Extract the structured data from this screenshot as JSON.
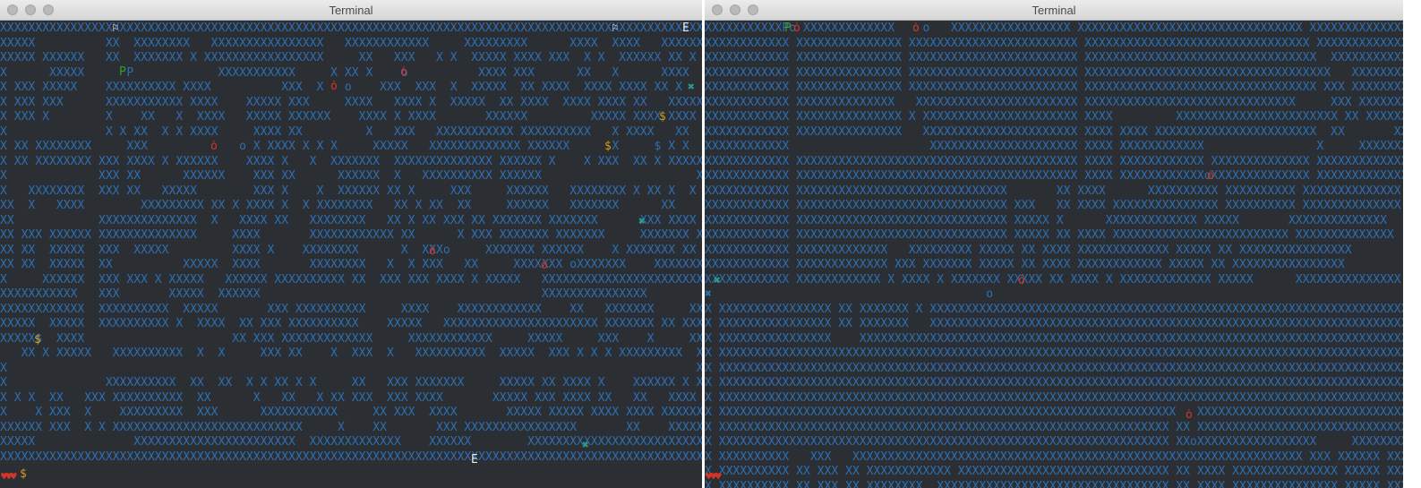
{
  "windows": [
    {
      "title": "Terminal",
      "map": [
        "XXXXXXXXXXXXXXXXXXXXXXXXXXXXXXXXXXXXXXXXXXXXXXXXXXXXXXXXXXXXXXXXXXXXXXXXXXXXXXXXXXXXXXXXXXXXXXXXXXXX",
        "XXXXX          XX  XXXXXXXX   XXXXXXXXXXXXXXXX   XXXXXXXXXXXX     XXXXXXXXX      XXXX  XXXX   XXXXXX",
        "XXXXX XXXXXX   XX  XXXXXXX X XXXXXXXXXXXXXXXXX     XX   XXX   X X  XXXXX XXXX XXX  X X  XXXXXX XX X",
        "X      XXXXX      P            XXXXXXXXXXX     X XX X    o          XXXX XXX      XX   X      XXXX",
        "X XXX XXXXX    XXXXXXXXXX XXXX          XXX  X   o    XXX  XXX  X  XXXXX  XX XXXX  XXXX XXXX XX X  ",
        "X XXX XXX      XXXXXXXXXXX XXXX    XXXXX XXX     XXXX   XXXX X  XXXXX  XX XXXX  XXXX XXXX XX   XXXXX",
        "X XXX X        X    XX   X  XXXX   XXXXX XXXXXX    XXXX X XXXX       XXXXXX         XXXXX XXXX XXXX $XX",
        "X              X X XX  X X XXXX     XXXX XX         X   XXX   XXXXXXXXXXX XXXXXXXXXX   X XXXX   XX  X",
        "X XX XXXXXXXX     XXX             o X XXXX X X X     XXXXX   XXXXXXXXXXXXX XXXXXX      X     $ X X  X",
        "X XX XXXXXXXX XXX XXXX X XXXXXX    XXXX X   X  XXXXXXX  XXXXXXXXXXXXXX XXXXXX X    X XXX  XX X XXXXX",
        "X             XXX XX      XXXXXX    XXX XX      XXXXXX  X   XXXXXXXXXX XXXXXX                      X",
        "X   XXXXXXXX  XXX XX   XXXXX        XXX X    X  XXXXXX XX X     XXX     XXXXXX   XXXXXXXX X XX X  X  X",
        "XX  X   XXXX        XXXXXXXXX XX X XXXX X  X XXXXXXXX   XX X XX  XX     XXXXXX   XXXXXXX      XX    XXX",
        "XX            XXXXXXXXXXXXXX  X   XXXX XX   XXXXXXXX   XX X XX XXX XX XXXXXXX XXXXXXX      XXX XXXX X",
        "XX XXX XXXXXX XXXXXXXXXXXXXX     XXXX       XXXXXXXXXXXX XX      X XXX XXXXXXX XXXXXXX     XXXXXXX XX",
        "XX XX  XXXXX  XXX  XXXXX         XXXX X    XXXXXXXX      X  XXXo     XXXXXXX XXXXXX    X XXXXXXX XX",
        "XX XX  XXXXX  XX          XXXXX  XXXX       XXXXXXXX   X  X XXX   XX     XXXXXXX oXXXXXXX    XXXXXXX XX",
        "X     XXXXXX  XXX XXX X XXXXX   XXXXXX XXXXXXXXXX XX  XXX XXX XXXX X XXXXX   XXXXXXXXXXXXXXXXXXXXXXX XX",
        "XXXXXXXXXXX   XXX       XXXXX  XXXXXX                                        XXXXXXXXXXXXXXX        XX",
        "XXXXXXXXXXXX  XXXXXXXXXX  XXXXX       XXX XXXXXXXXXX     XXXX    XXXXXXXXXXXX    XX   XXXXXXX     XXXX XX",
        "XXXXX  XXXXX  XXXXXXXXXX X  XXXX  XX XXX XXXXXXXXXX    XXXXX   XXXXXXXXXXXXXXXXXXXXXX XXXXXXX XX XXXX XX",
        "XXXXX$  XXXX                     XX XXX XXXXXXXXXXXXX     XXXXXXXXXXXX     XXXXX     XXX    X     XXXX   X",
        "   XX X XXXXX   XXXXXXXXXX  X  X     XXX XX    X  XXX  X   XXXXXXXXXX  XXXXX  XXX X X X XXXXXXXXX  X",
        "X                                                                                                  X",
        "X              XXXXXXXXXX  XX  XX  X X XX X X     XX   XXX XXXXXXX     XXXXX XX XXXX X    XXXXXX X XXX",
        "X X X  XX   XXX XXXXXXXXXX  XX      X   XX   X XX XXX  XXX XXXX       XXXXX XXX XXXX XX   XX   XXXX",
        "X    X XXX  X    XXXXXXXXX  XXX      XXXXXXXXXXX     XX XXX  XXXX       XXXXX XXXXX XXXX XXXX XXXXXXXX",
        "XXXXXX XXX  X X XXXXXXXXXXXXXXXXXXXXXXXXXXX     X    XX       XXX XXXXXXXXXXXXXXXX       XX    XXXXXXX",
        "XXXXX              XXXXXXXXXXXXXXXXXXXXXXX  XXXXXXXXXXXXX    XXXXXX        XXXXXXXXXXXXXXXXXXXXXXXXXXXXX",
        "XXXXXXXXXXXXXXXXXXXXXXXXXXXXXXXXXXXXXXXXXXXXXXXXXXXXXXXXXXXXXXXXXXXXXXXXXXXXXXXXXXXXXXXXXXXXXXXXXXXXXX"
      ],
      "markers": {
        "player": "P",
        "enemy": "ȯ",
        "gold": "$",
        "gem": "✖",
        "exit": "E",
        "flag": "⚐"
      },
      "hud": {
        "hearts": "♥♥♥",
        "gold": "$"
      }
    },
    {
      "title": "Terminal",
      "map": [
        "XXXXXXXXXXXPo XXXXXXXXXXXXX    o   XXXXXXXXXXXXXXXXX XXXXXXXXXXXXXXXXXXXXXXXXXXXXXXXX XXXXXXXXXXXXXX",
        "XXXXXXXXXXXX XXXXXXXXXXXXXXX XXXXXXXXXXXXXXXXXXXXXXXX XXXXXXXXXXXXXXXXXXXXXXXXXXXXXXXX XXXXXXXXXXXXXX",
        "XXXXXXXXXXXX XXXXXXXXXXXXXXX XXXXXXXXXXXXXXXXXXXXXXXX XXXXXXXXXXXXXXXXXXXXXXXXXXXXXXXXX  XXXXXXXXXXXX",
        "XXXXXXXXXXXX XXXXXXXXXXXXXXX XXXXXXXXXXXXXXXXXXXXXXXX XXXXXXXXXXXXXXXXXXXXXXXXXXXXXXXXXXX   XXXXXXXXX",
        "XXXXXXXXXXXX XXXXXXXXXXXXXXX XXXXXXXXXXXXXXXXXXXXXXXX XXXXXXXXXXXXXXXXXXXXXXXXXXXXXXXXX XXX XXXXXXXX",
        "XXXXXXXXXXXX XXXXXXXXXXXXXX   XXXXXXXXXXXXXXXXXXXXXXX XXXXXXXXXXXXXXXXXXXXXXXXXXXXXX     XXX XXXXXXXX",
        "XXXXXXXXXXXX XXXXXXXXXXXXXXX X XXXXXXXXXXXXXXXXXXXXXX XXXX         XXXXXXXXXXXXXXXXXXXXXXX XX XXXXXXXXX",
        "XXXXXXXXXXXX XXXXXXXXXXXXXXX   XXXXXXXXXXXXXXXXXXXXXX XXXX XXXX XXXXXXXXXXXXXXXXXXXXXXX  XX       XXXX",
        "XXXXXXXXXXXX                    XXXXXXXXXXXXXXXXXXXXX XXXX XXXXXXXXXXXX                X     XXXXXXXXXX",
        "XXXXXXXXXXXX XXXXXXXXXXXXXXXXXXXXXXXXXXXXXXXXXXXXXXXX XXXX XXXXXXXXXXXX XXXXXXXXXXXXXX XXXXXXXXXXXXXX",
        "XXXXXXXXXXXX XXXXXXXXXXXXXXXXXXXXXXXXXXXXXXXXXXXXXXXX XXXX XXXXXXXXXXXXoXXXXXXXXXXXXXX XXXXXXXXXXXXXX",
        "XXXXXXXXXXXX XXXXXXXXXXXXXXXXXXXXXXXXXXXXXX       XX XXXX      XXXXXXXXXX XXXXXXXXXX XXXXXXXXXXXXXX",
        "XXXXXXXXXXXX XXXXXXXXXXXXXXXXXXXXXXXXXXXXXX XXX   XX XXXX XXXXXXXXXXXXXXX XXXXXXXXXX XXXXXXXXXXXXXX",
        "XXXXXXXXXXXX XXXXXXXXXXXXXXXXXXXXXXXXXXXXXX XXXXX X      XXXXXXXXXXXXX XXXXX       XXXXXXXXXXXXXX",
        "XXXXXXXXXXXX XXXXXXXXXXXXXXXXXXXXXXXXXXXXXX XXXXX XX XXXX XXXXXXXXXXXXXXXXXXXXXXXXX XXXXXXXXXXXXXX",
        "XXXXXXXXXXXX XXXXXXXXXXXXX   XXXXXXXXX XXXXX XX XXXX XXXXXXXXXXXXX XXXXX XX XXXXXXXXXXXXXXXX",
        "XXXXXXXXXXXX XXXXXXXXXXXXX XXX XXXXXXX XXXXX XX XXXX XXXXXXXXXXXX XXXXX XX XXXXXXXXXXXXXXXX",
        "XXXXXXXXXXXX XXXXXXXXXXXX X XXXX X XXXXXXX XXXXX XX XXXX X XXXXXXXXXXXXX XXXXX      XXXXXXXXXXXXXXX",
        "✖                                       o                                                          ",
        "X XXXXXXXXXXXXXXXX XX XXXXXXX X XXXXXXXXXXXXXXXXXXXXXXXXXXXXXXXXXXXXXXXXXXXXXXXXXXXXXXXXXXXXXXXXXXXXXX",
        "X XXXXXXXXXXXXXXXX XX XXXXXXX   XXXXXXXXXXXXXXXXXXXXXXXXXXXXXXXXXXXXXXXXXXXXXXXXXXXXXXXXXXXXXXXXXXXXXX",
        "X XXXXXXXXXXXXXXXX    XXXXXXXXXXXXXXXXXXXXXXXXXXXXXXXXXXXXXXXXXXXXXXXXXXXXXXXXXXXXXXXXXXXXXXXXXXXXXXX",
        "X XXXXXXXXXXXXXXXXXXXXXXXXXXXXXXXXXXXXXXXXXXXXXXXXXXXXXXXXXXXXXXXXXXXXXXXXXXXXXXXXXXXXXXXXXXXXXXXXXXXX",
        "X XXXXXXXXXXXXXXXXXXXXXXXXXXXXXXXXXXXXXXXXXXXXXXXXXXXXXXXXXXXXXXXXXXXXXXXXXXXXXXXXXXXXXXXXXXXXXXXXXXXX",
        "X XXXXXXXXXXXXXXXXXXXXXXXXXXXXXXXXXXXXXXXXXXXXXXXXXXXXXXXXXXXXXXXXXXXXXXXXXXXXXXXXXXXXXXXXXXXXXXXXXXXX",
        "X XXXXXXXXXXXXXXXXXXXXXXXXXXXXXXXXXXXXXXXXXXXXXXXXXXXXXXXXXXXXXXXXXXXXXXXXXXXXXXXXXXXXXXXXXXXXXXXXXXXX",
        "X XXXXXXXXXXXXXXXXXXXXXXXXXXXXXXXXXXXXXXXXXXXXXXXXXXXXXXXXXXXXXXXXX   XXXXXXXXXXXXXXXXXXXXXXXXXXXXXXX",
        "X XXXXXXXXXXXXXXXXXXXXXXXXXXXXXXXXXXXXXXXXXXXXXXXXXXXXXXXXXXXXXXXX XX XXXXXXXXXXXXXXXXXXXXXXXXXXXXXXXX",
        "X XXXXXXXXXXXXXXXXXXXXXXXXXXXXXXXXXXXXXXXXXXXXXXXXXXXXXXXXXXXXXXXX XXoXXXXXXXXXXXXXXXXX     XXXXXXXXXX",
        "X XXXXXXXXXX   XXX   XXXXXXXXXXXXXXXXXXXXXXXXXXXXXXXXXXXXXXXXXXXXXXXXXXXXXXXXXXXXXXXX XXX XXXXXX XXXX",
        "X XXXXXXXXXX XX XXX XX XXXXXXXXXXXX XXXXXXXXXXXXXXXXXXXXXXXXXXXXXX XX XXXX XXXXXXXXXXXXXXX XXXXX XXXX",
        "X XXXXXXXXXX XX XXX XX XXXXXXXX  XXXXXXXXXXXXXXXXXXXXXXXXXXXXXXXXX XX XXXX XXXXXXXXXXXXXXX XXXXX XXXX"
      ],
      "markers": {
        "player": "P",
        "enemy": "ȯ",
        "gem": "✖"
      },
      "hud": {
        "hearts": "♥♥♥"
      }
    }
  ]
}
